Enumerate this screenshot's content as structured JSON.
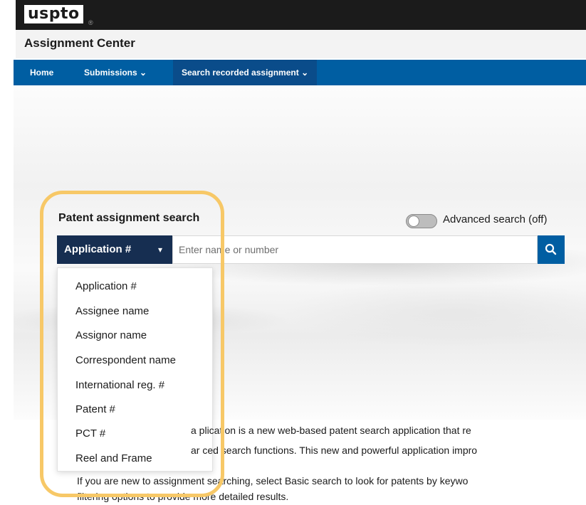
{
  "header": {
    "logo": "uspto",
    "logo_mark": "®",
    "app_title": "Assignment Center"
  },
  "nav": {
    "home": "Home",
    "submissions": "Submissions  ⌄",
    "search_recorded": "Search recorded assignment  ⌄"
  },
  "search": {
    "title": "Patent assignment search",
    "advanced_toggle_label": "Advanced search (off)",
    "advanced_toggle_state": "off",
    "type_selected": "Application #",
    "input_value": "",
    "input_placeholder": "Enter name or number",
    "search_icon": "search-icon",
    "type_options": [
      "Application #",
      "Assignee name",
      "Assignor name",
      "Correspondent name",
      "International reg. #",
      "Patent #",
      "PCT #",
      "Reel and Frame"
    ]
  },
  "intro": {
    "line_1": "a plication is a new web-based patent search application that re",
    "line_2": "ar ced search functions. This new and powerful application impro",
    "line_3": "If you are new to assignment searching, select Basic search to look for patents by keywo",
    "line_4": "filtering options to provide more detailed results."
  },
  "colors": {
    "nav_bar": "#005ea2",
    "select_button": "#162e51",
    "search_button": "#005ea2",
    "highlight": "#f7c867"
  }
}
